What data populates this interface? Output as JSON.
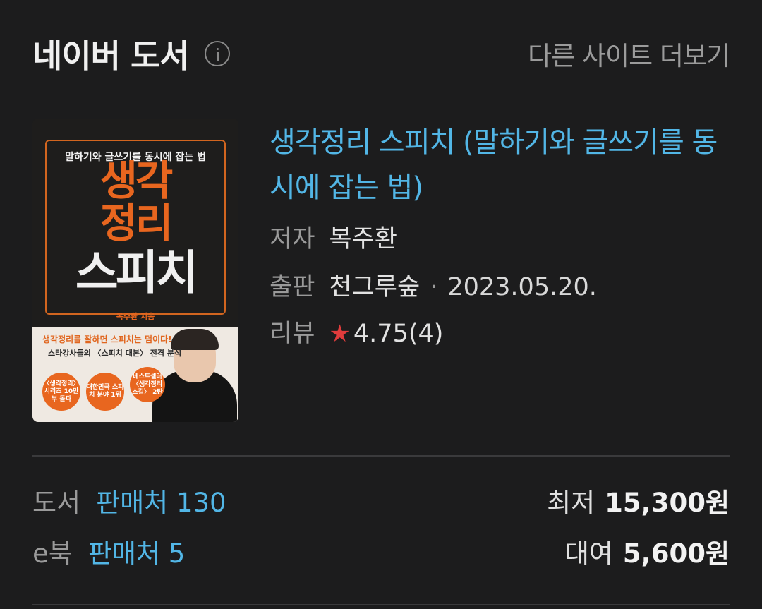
{
  "header": {
    "title": "네이버 도서",
    "more_link": "다른 사이트 더보기"
  },
  "book": {
    "title": "생각정리 스피치 (말하기와 글쓰기를 동시에 잡는 법)",
    "author_label": "저자",
    "author": "복주환",
    "publisher_label": "출판",
    "publisher": "천그루숲",
    "date": "2023.05.20.",
    "review_label": "리뷰",
    "rating": "4.75(4)",
    "star_icon": "★"
  },
  "cover": {
    "subtitle": "말하기와 글쓰기를 동시에 잡는 법",
    "title_line1": "생각",
    "title_line1b": "정리",
    "title_line2": "스피치",
    "author": "복주환 지음",
    "headline": "생각정리를 잘하면 스피치는 덤이다!",
    "subheadline": "스타강사들의 〈스피치 대본〉 전격 분석",
    "badges": [
      "〈생각정리〉 시리즈 10만 부 돌파",
      "대한민국 스피치 분야 1위",
      "베스트셀러 〈생각정리스킬〉 2탄"
    ]
  },
  "purchase": {
    "rows": [
      {
        "label": "도서",
        "seller": "판매처 130",
        "price_label": "최저",
        "price": "15,300원"
      },
      {
        "label": "e북",
        "seller": "판매처 5",
        "price_label": "대여",
        "price": "5,600원"
      }
    ]
  }
}
